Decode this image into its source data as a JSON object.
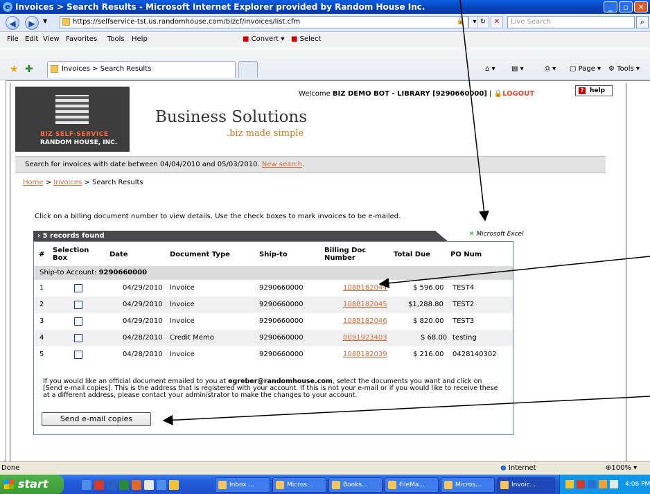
{
  "window": {
    "title": "Invoices > Search Results - Microsoft Internet Explorer provided by Random House Inc."
  },
  "addressbar": {
    "url": "https://selfservice-tst.us.randomhouse.com/bizcf/invoices/list.cfm",
    "search_placeholder": "Live Search"
  },
  "menubar": {
    "items": [
      "File",
      "Edit",
      "View",
      "Favorites",
      "Tools",
      "Help"
    ],
    "convert": "Convert",
    "select": "Select"
  },
  "tabbar": {
    "active_tab": "Invoices > Search Results",
    "page_menu": "Page",
    "tools_menu": "Tools"
  },
  "header": {
    "welcome_prefix": "Welcome ",
    "user": "BIZ DEMO BOT - LIBRARY [9290660000]",
    "separator": " | ",
    "logout": "LOGOUT",
    "help": "help",
    "logo_line1": "BIZ SELF-SERVICE",
    "logo_line2": "RANDOM HOUSE, INC.",
    "brand_title": "Business Solutions",
    "brand_sub": ".biz made simple"
  },
  "search_info": {
    "text": "Search for invoices with date between 04/04/2010 and 05/03/2010. ",
    "new_search": "New search",
    "period": "."
  },
  "breadcrumb": {
    "home": "Home",
    "sep1": " > ",
    "invoices": "Invoices",
    "sep2": " > ",
    "current": "Search Results"
  },
  "instructions": "Click on a billing document number to view details. Use the check boxes to mark invoices to be e-mailed.",
  "records_found": "5 records found",
  "excel_label": "Microsoft Excel",
  "table": {
    "headers": {
      "num": "#",
      "selection": "Selection Box",
      "date": "Date",
      "doc_type": "Document Type",
      "ship_to": "Ship-to",
      "billing": "Billing Doc Number",
      "total": "Total Due",
      "po": "PO Num"
    },
    "ship_to_label": "Ship-to Account: ",
    "ship_to_account": "9290660000",
    "rows": [
      {
        "num": "1",
        "date": "04/29/2010",
        "type": "Invoice",
        "ship_to": "9290660000",
        "doc": "1088182044",
        "total": "$ 596.00",
        "po": "TEST4"
      },
      {
        "num": "2",
        "date": "04/29/2010",
        "type": "Invoice",
        "ship_to": "9290660000",
        "doc": "1088182045",
        "total": "$1,288.80",
        "po": "TEST2"
      },
      {
        "num": "3",
        "date": "04/29/2010",
        "type": "Invoice",
        "ship_to": "9290660000",
        "doc": "1088182046",
        "total": "$ 820.00",
        "po": "TEST3"
      },
      {
        "num": "4",
        "date": "04/28/2010",
        "type": "Credit Memo",
        "ship_to": "9290660000",
        "doc": "0091923403",
        "total": "$ 68.00",
        "po": "testing"
      },
      {
        "num": "5",
        "date": "04/28/2010",
        "type": "Invoice",
        "ship_to": "9290660000",
        "doc": "1088182039",
        "total": "$ 216.00",
        "po": "0428140302"
      }
    ]
  },
  "email_note": {
    "part1": "If you would like an official document emailed to you at ",
    "email": "egreber@randomhouse.com",
    "part2": ", select the documents you want and click on [Send e-mail copies]. This is the address that is registered with your account. If this is not your e-mail or if you would like to receive these at a different address, please contact your administrator to make the changes to your account."
  },
  "send_button": "Send e-mail copies",
  "statusbar": {
    "status": "Done",
    "zone": "Internet",
    "zoom": "100%"
  },
  "taskbar": {
    "start": "start",
    "tasks": [
      "Inbox ...",
      "Micros...",
      "Books...",
      "FileMa...",
      "Micros...",
      "Invoic..."
    ],
    "clock": "4:06 PM"
  },
  "colors": {
    "link": "#d26a3a",
    "title_bar": "#0841b6",
    "header_band": "#4a4a4a"
  }
}
